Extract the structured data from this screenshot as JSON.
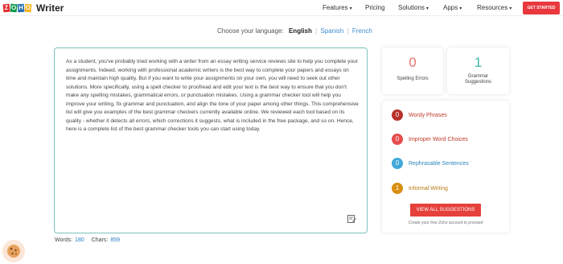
{
  "header": {
    "logo_letters": [
      "Z",
      "O",
      "H",
      "O"
    ],
    "app_name": "Writer",
    "nav": [
      {
        "label": "Features",
        "caret": true
      },
      {
        "label": "Pricing",
        "caret": false
      },
      {
        "label": "Solutions",
        "caret": true
      },
      {
        "label": "Apps",
        "caret": true
      },
      {
        "label": "Resources",
        "caret": true
      }
    ],
    "cta_label": "GET STARTED",
    "caret_glyph": "▾"
  },
  "language": {
    "prompt": "Choose your language:",
    "selected": "English",
    "separator": "|",
    "options": [
      "Spanish",
      "French"
    ]
  },
  "editor": {
    "text": "As a student, you've probably tried working with a writer from an essay writing service reviews site to help you complete your assignments. Indeed, working with professional academic writers is the best way to complete your papers and essays on time and maintain high quality. But if you want to write your assignments on your own, you will need to seek out other solutions. More specifically, using a spell checker to proofread and edit your text is the best way to ensure that you don't make any spelling mistakes, grammatical errors, or punctuation mistakes. Using a grammar checker tool will help you improve your writing, fix grammar and punctuation, and align the tone of your paper among other things. This comprehensive list will give you examples of the best grammar checkers currently available online. We reviewed each tool based on its quality - whether it detects all errors, which corrections it suggests, what is included in the free package, and so on. Hence, here is a complete list of the best grammar checker tools you can start using today.",
    "words_label": "Words:",
    "words_value": "180",
    "chars_label": "Chars:",
    "chars_value": "859"
  },
  "scores": {
    "spelling_count": "0",
    "spelling_label": "Spelling Errors",
    "grammar_count": "1",
    "grammar_label_line1": "Grammar",
    "grammar_label_line2": "Suggestions"
  },
  "suggestions": {
    "items": [
      {
        "count": "0",
        "label": "Wordy Phrases",
        "badge_color": "#b8312c",
        "label_color": "#c0392b"
      },
      {
        "count": "0",
        "label": "Improper Word Choices",
        "badge_color": "#e74c4c",
        "label_color": "#c0392b"
      },
      {
        "count": "0",
        "label": "Rephrasable Sentences",
        "badge_color": "#3fa9d8",
        "label_color": "#2e86b8"
      },
      {
        "count": "1",
        "label": "Informal Writing",
        "badge_color": "#d98f10",
        "label_color": "#b97a12"
      }
    ],
    "button_label": "VIEW ALL SUGGESTIONS",
    "note": "Create your free Zoho account to proceed"
  },
  "colors": {
    "accent_red": "#e8383d",
    "teal_border": "#7cc3bd",
    "link_blue": "#3e8ed0"
  },
  "icons": [
    "edit-doc-icon",
    "cookie-icon",
    "caret-down-icon"
  ]
}
